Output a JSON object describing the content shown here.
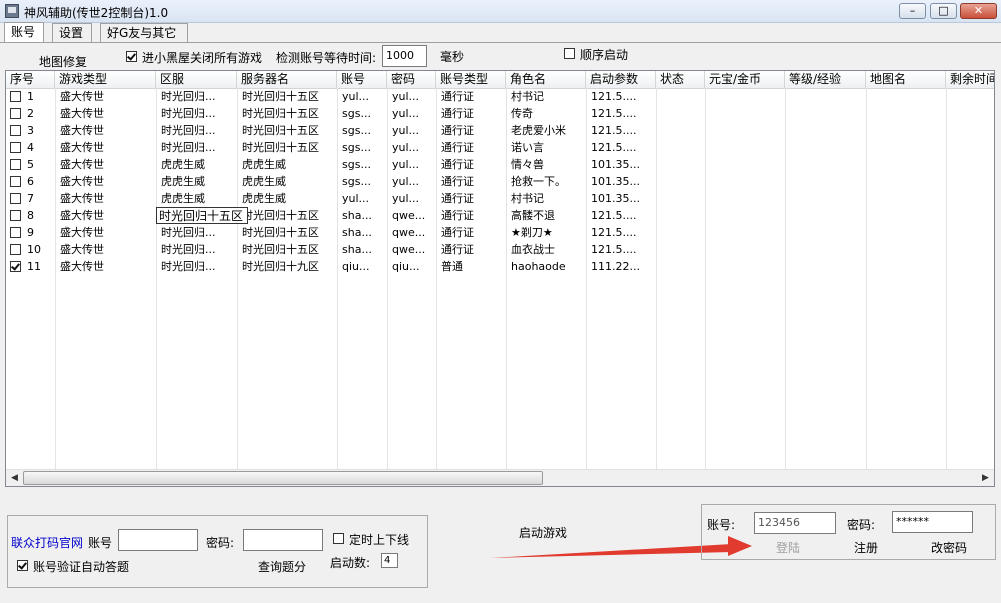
{
  "window": {
    "title": "神风辅助(传世2控制台)1.0"
  },
  "tabs": [
    "账号",
    "设置",
    "好G友与其它"
  ],
  "toolbar": {
    "map_repair": "地图修复",
    "blackroom_label": "进小黑屋关闭所有游戏",
    "blackroom_checked": true,
    "wait_label": "检测账号等待时间:",
    "wait_value": "1000",
    "wait_unit": "毫秒",
    "sequential_label": "顺序启动",
    "sequential_checked": false
  },
  "table": {
    "columns": [
      "序号",
      "游戏类型",
      "区服",
      "服务器名",
      "账号",
      "密码",
      "账号类型",
      "角色名",
      "启动参数",
      "状态",
      "元宝/金币",
      "等级/经验",
      "地图名",
      "剩余时间"
    ],
    "rows": [
      {
        "checked": false,
        "cells": [
          "1",
          "盛大传世",
          "时光回归...",
          "时光回归十五区",
          "yul...",
          "yul...",
          "通行证",
          "村书记",
          "121.5....",
          "",
          "",
          "",
          "",
          ""
        ]
      },
      {
        "checked": false,
        "cells": [
          "2",
          "盛大传世",
          "时光回归...",
          "时光回归十五区",
          "sgs...",
          "yul...",
          "通行证",
          "传奇",
          "121.5....",
          "",
          "",
          "",
          "",
          ""
        ]
      },
      {
        "checked": false,
        "cells": [
          "3",
          "盛大传世",
          "时光回归...",
          "时光回归十五区",
          "sgs...",
          "yul...",
          "通行证",
          "老虎爱小米",
          "121.5....",
          "",
          "",
          "",
          "",
          ""
        ]
      },
      {
        "checked": false,
        "cells": [
          "4",
          "盛大传世",
          "时光回归...",
          "时光回归十五区",
          "sgs...",
          "yul...",
          "通行证",
          "诺い言",
          "121.5....",
          "",
          "",
          "",
          "",
          ""
        ]
      },
      {
        "checked": false,
        "cells": [
          "5",
          "盛大传世",
          "虎虎生威",
          "虎虎生威",
          "sgs...",
          "yul...",
          "通行证",
          "情々兽",
          "101.35...",
          "",
          "",
          "",
          "",
          ""
        ]
      },
      {
        "checked": false,
        "cells": [
          "6",
          "盛大传世",
          "虎虎生威",
          "虎虎生威",
          "sgs...",
          "yul...",
          "通行证",
          "抢救一下。",
          "101.35...",
          "",
          "",
          "",
          "",
          ""
        ]
      },
      {
        "checked": false,
        "cells": [
          "7",
          "盛大传世",
          "虎虎生威",
          "虎虎生威",
          "yul...",
          "yul...",
          "通行证",
          "村书记",
          "101.35...",
          "",
          "",
          "",
          "",
          ""
        ]
      },
      {
        "checked": false,
        "cells": [
          "8",
          "盛大传世",
          "时光回归十五区",
          "时光回归十五区",
          "sha...",
          "qwe...",
          "通行证",
          "高髅不退",
          "121.5....",
          "",
          "",
          "",
          "",
          ""
        ]
      },
      {
        "checked": false,
        "cells": [
          "9",
          "盛大传世",
          "时光回归...",
          "时光回归十五区",
          "sha...",
          "qwe...",
          "通行证",
          "★剃刀★",
          "121.5....",
          "",
          "",
          "",
          "",
          ""
        ]
      },
      {
        "checked": false,
        "cells": [
          "10",
          "盛大传世",
          "时光回归...",
          "时光回归十五区",
          "sha...",
          "qwe...",
          "通行证",
          "血衣战士",
          "121.5....",
          "",
          "",
          "",
          "",
          ""
        ]
      },
      {
        "checked": true,
        "cells": [
          "11",
          "盛大传世",
          "时光回归...",
          "时光回归十九区",
          "qiu...",
          "qiu...",
          "普通",
          "haohaode",
          "111.22...",
          "",
          "",
          "",
          "",
          ""
        ]
      }
    ]
  },
  "bottom": {
    "site_link": "联众打码官网",
    "account_label": "账号",
    "account_value": "",
    "password_label": "密码:",
    "password_value": "",
    "timed_label": "定时上下线",
    "timed_checked": false,
    "auto_answer_label": "账号验证自动答题",
    "auto_answer_checked": true,
    "query_label": "查询题分",
    "launch_count_label": "启动数:",
    "launch_count_value": "4",
    "start_game": "启动游戏"
  },
  "login": {
    "account_label": "账号:",
    "account_value": "123456",
    "password_label": "密码:",
    "password_value": "******",
    "login_button": "登陆",
    "register_button": "注册",
    "change_pwd_button": "改密码"
  },
  "colors": {
    "link": "#0000cc",
    "arrow": "#e03b2e"
  }
}
